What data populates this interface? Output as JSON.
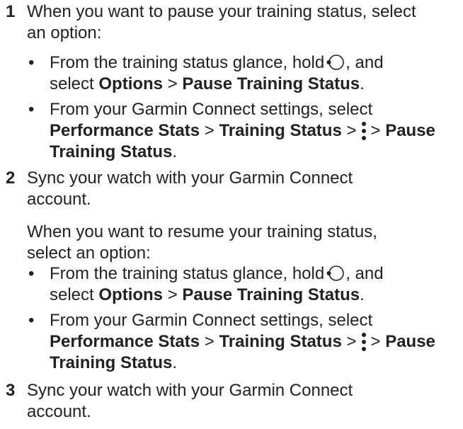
{
  "steps": [
    {
      "number": "1",
      "intro_l1": "When you want to pause your training status, select",
      "intro_l2": "an option:",
      "bullets": [
        {
          "a": "From the training status glance, hold",
          "b": ", and",
          "c": "select",
          "bold1": "Options",
          "sep": ">",
          "bold2": "Pause Training Status",
          "end": "."
        },
        {
          "a": "From your Garmin Connect settings, select",
          "bold1": "Performance Stats",
          "sep1": ">",
          "bold2": "Training Status",
          "sep2": ">",
          "sep3": ">",
          "bold3": "Pause",
          "bold4": "Training Status",
          "end": "."
        }
      ]
    },
    {
      "number": "2",
      "l1": "Sync your watch with your Garmin Connect",
      "l2": "account.",
      "p1": "When you want to resume your training status,",
      "p2": "select an option:",
      "bullets": [
        {
          "a": "From the training status glance, hold",
          "b": ", and",
          "c": "select",
          "bold1": "Options",
          "sep": ">",
          "bold2": "Pause Training Status",
          "end": "."
        },
        {
          "a": "From your Garmin Connect settings, select",
          "bold1": "Performance Stats",
          "sep1": ">",
          "bold2": "Training Status",
          "sep2": ">",
          "sep3": ">",
          "bold3": "Pause",
          "bold4": "Training Status",
          "end": "."
        }
      ]
    },
    {
      "number": "3",
      "l1": "Sync your watch with your Garmin Connect",
      "l2": "account."
    }
  ],
  "bullet_char": "•",
  "icons": {
    "watch_button": "watch-button-icon",
    "menu": "more-menu-icon"
  }
}
